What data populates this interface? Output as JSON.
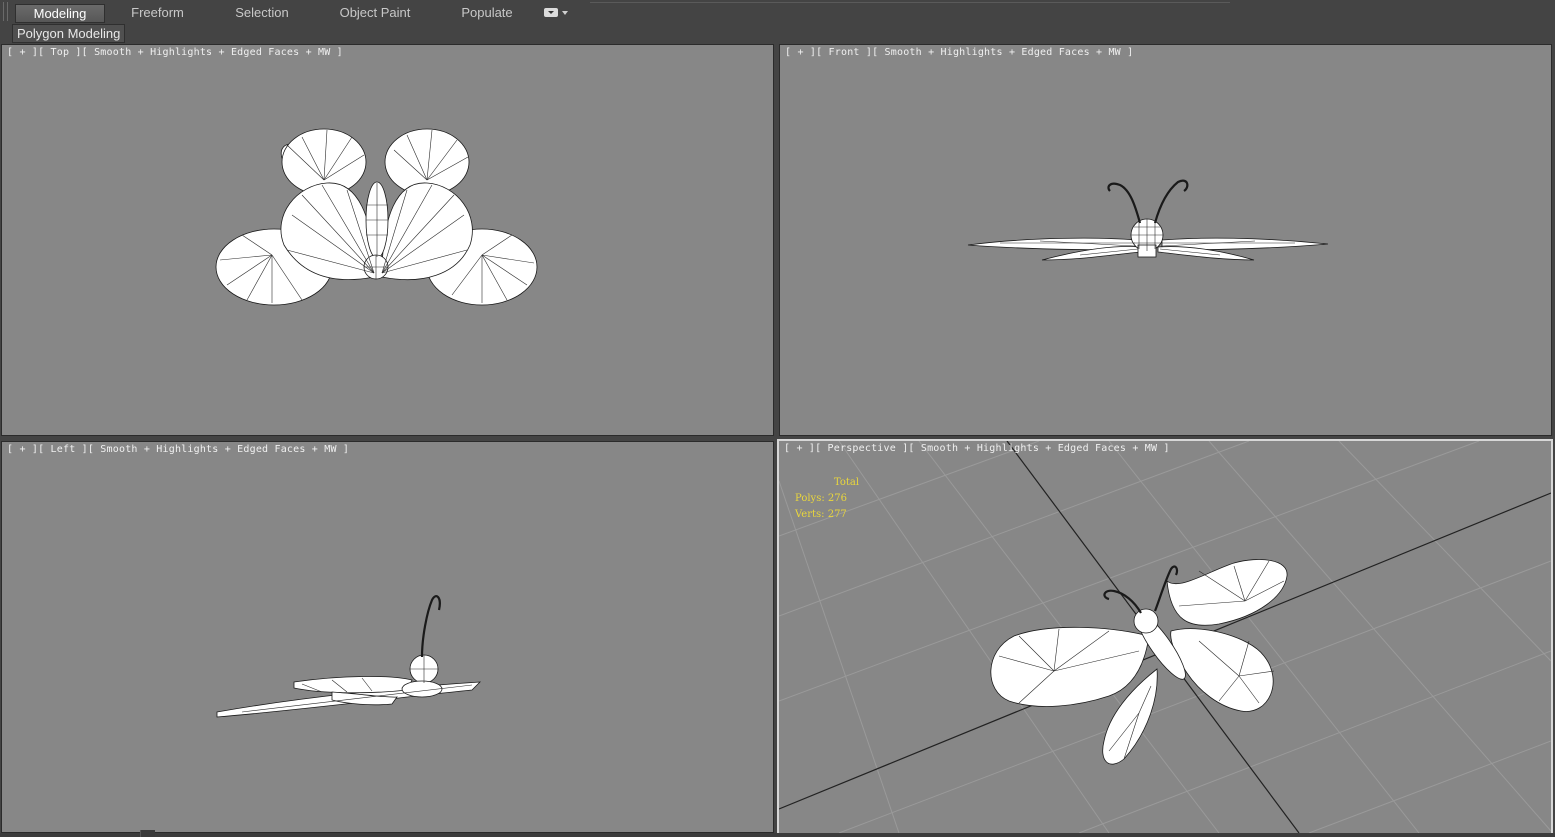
{
  "ribbon": {
    "tabs": [
      "Modeling",
      "Freeform",
      "Selection",
      "Object Paint",
      "Populate"
    ],
    "active_tab": "Modeling",
    "panel": "Polygon Modeling"
  },
  "viewports": {
    "top": {
      "label": "[ + ][ Top ][ Smooth + Highlights + Edged Faces + MW ]"
    },
    "front": {
      "label": "[ + ][ Front ][ Smooth + Highlights + Edged Faces + MW ]"
    },
    "left": {
      "label": "[ + ][ Left ][ Smooth + Highlights + Edged Faces + MW ]"
    },
    "perspective": {
      "label": "[ + ][ Perspective ][ Smooth + Highlights + Edged Faces + MW ]",
      "stats": {
        "header": "Total",
        "polys": "Polys:  276",
        "verts": "Verts:  277"
      }
    }
  },
  "colors": {
    "viewport_bg": "#878787",
    "ui_bg": "#444444",
    "stats_text": "#e9d63c",
    "active_border": "#d7d7d7"
  }
}
